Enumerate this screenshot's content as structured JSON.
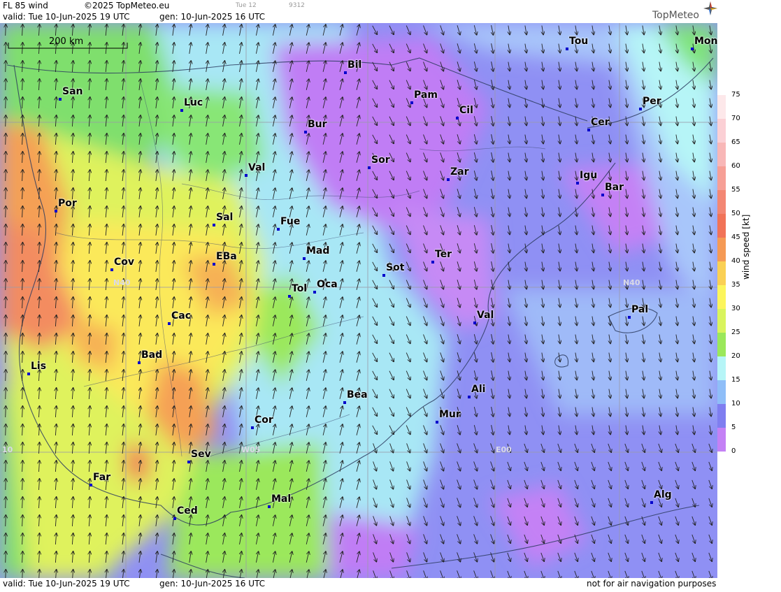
{
  "header": {
    "product": "FL 85 wind",
    "copyright": "©2025 TopMeteo.eu",
    "day_tab": "Tue 12",
    "code": "9312",
    "valid": "valid:  Tue  10-Jun-2025  19 UTC",
    "generated": "gen: 10-Jun-2025 16 UTC"
  },
  "footer": {
    "valid": "valid:  Tue  10-Jun-2025  19 UTC",
    "generated": "gen: 10-Jun-2025 16 UTC",
    "disclaimer": "not for air navigation purposes"
  },
  "logo": {
    "text": "TopMeteo",
    "icon": "compass-star-icon"
  },
  "map": {
    "scale_bar": "200 km",
    "grid_labels": {
      "lat40_west": "N40",
      "lat40_east": "N40",
      "lon_w05": "W05",
      "lon_e00": "E00",
      "lon_w10": "10"
    },
    "cities": [
      {
        "name": "San"
      },
      {
        "name": "Luc"
      },
      {
        "name": "Bil"
      },
      {
        "name": "Pam"
      },
      {
        "name": "Cil"
      },
      {
        "name": "Tou"
      },
      {
        "name": "Mon"
      },
      {
        "name": "Per"
      },
      {
        "name": "Bur"
      },
      {
        "name": "Cer"
      },
      {
        "name": "Sor"
      },
      {
        "name": "Val"
      },
      {
        "name": "Zar"
      },
      {
        "name": "Igu"
      },
      {
        "name": "Bar"
      },
      {
        "name": "Por"
      },
      {
        "name": "Sal"
      },
      {
        "name": "Fue"
      },
      {
        "name": "Mad"
      },
      {
        "name": "Cov"
      },
      {
        "name": "EBa"
      },
      {
        "name": "Sot"
      },
      {
        "name": "Ter"
      },
      {
        "name": "Tol"
      },
      {
        "name": "Oca"
      },
      {
        "name": "Cac"
      },
      {
        "name": "Val"
      },
      {
        "name": "Pal"
      },
      {
        "name": "Bad"
      },
      {
        "name": "Lis"
      },
      {
        "name": "Ali"
      },
      {
        "name": "Bea"
      },
      {
        "name": "Mur"
      },
      {
        "name": "Cor"
      },
      {
        "name": "Sev"
      },
      {
        "name": "Far"
      },
      {
        "name": "Mal"
      },
      {
        "name": "Ced"
      },
      {
        "name": "Alg"
      }
    ]
  },
  "legend": {
    "title": "wind speed  [kt]",
    "ticks": [
      "75",
      "70",
      "65",
      "60",
      "55",
      "50",
      "45",
      "40",
      "35",
      "30",
      "25",
      "20",
      "15",
      "10",
      "5",
      "0"
    ],
    "colors": [
      "#ffffff",
      "#fde8ea",
      "#fbd0d5",
      "#f8b7b7",
      "#f69f96",
      "#f38774",
      "#f17358",
      "#f59a55",
      "#fad054",
      "#fcf55c",
      "#d9f45e",
      "#9be85b",
      "#b6f5f7",
      "#8fbef8",
      "#7f7ef0",
      "#c481f5"
    ]
  },
  "colors": {
    "city_dot": "#0000cc",
    "water_high_speed_orange": "#f5a055",
    "purple_low": "#c481f5"
  }
}
